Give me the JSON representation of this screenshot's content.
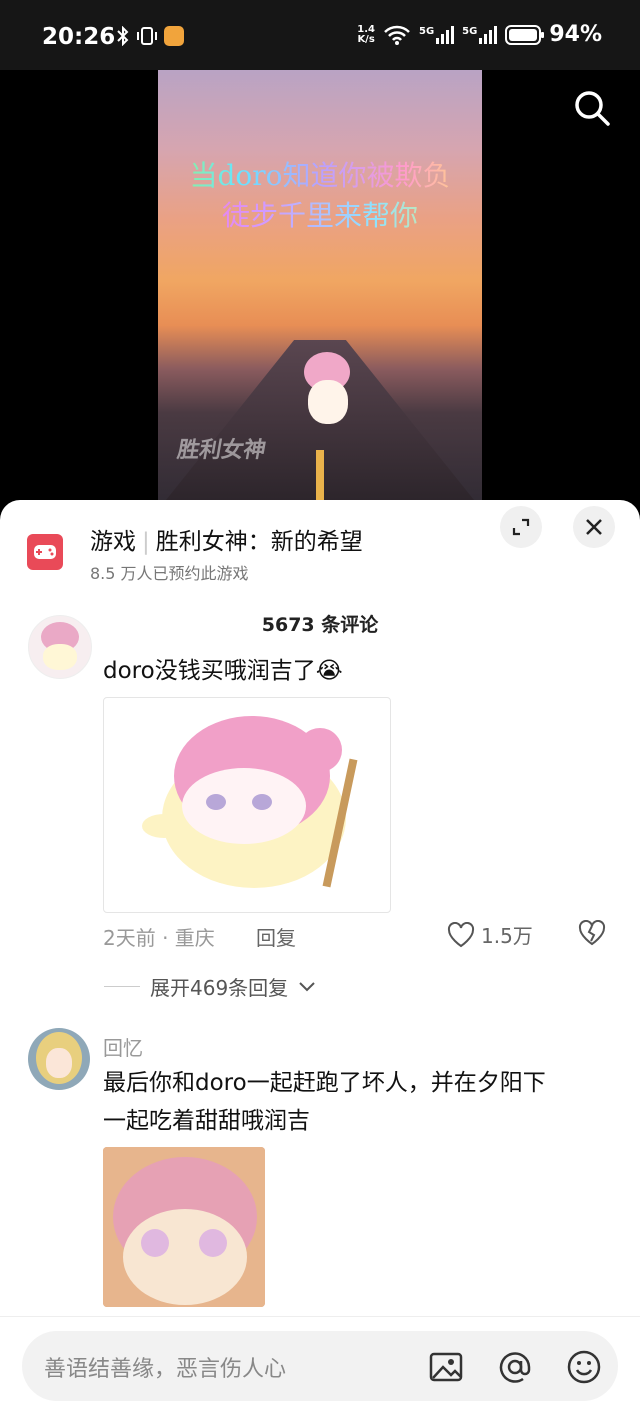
{
  "status_bar": {
    "time": "20:26",
    "net_speed_value": "1.4",
    "net_speed_unit": "K/s",
    "signal1": "5G",
    "signal2": "5G",
    "battery": "94%"
  },
  "video": {
    "overlay_line1": "当doro知道你被欺负",
    "overlay_line2": "徒步千里来帮你",
    "logo_text": "胜利女神"
  },
  "game": {
    "title_prefix": "游戏",
    "title": "胜利女神：新的希望",
    "subtitle": "8.5 万人已预约此游戏"
  },
  "comments_header": {
    "count_label": "5673 条评论"
  },
  "comment1": {
    "text": "doro没钱买哦润吉了😭",
    "meta": "2天前 · 重庆",
    "reply_label": "回复",
    "likes": "1.5万",
    "expand_label": "展开469条回复"
  },
  "comment2": {
    "username": "回忆",
    "line1": "最后你和doro一起赶跑了坏人，并在夕阳下",
    "line2": "一起吃着甜甜哦润吉"
  },
  "input_bar": {
    "placeholder": "善语结善缘，恶言伤人心"
  },
  "colors": {
    "accent": "#e94a58",
    "muted_text": "#999999"
  }
}
